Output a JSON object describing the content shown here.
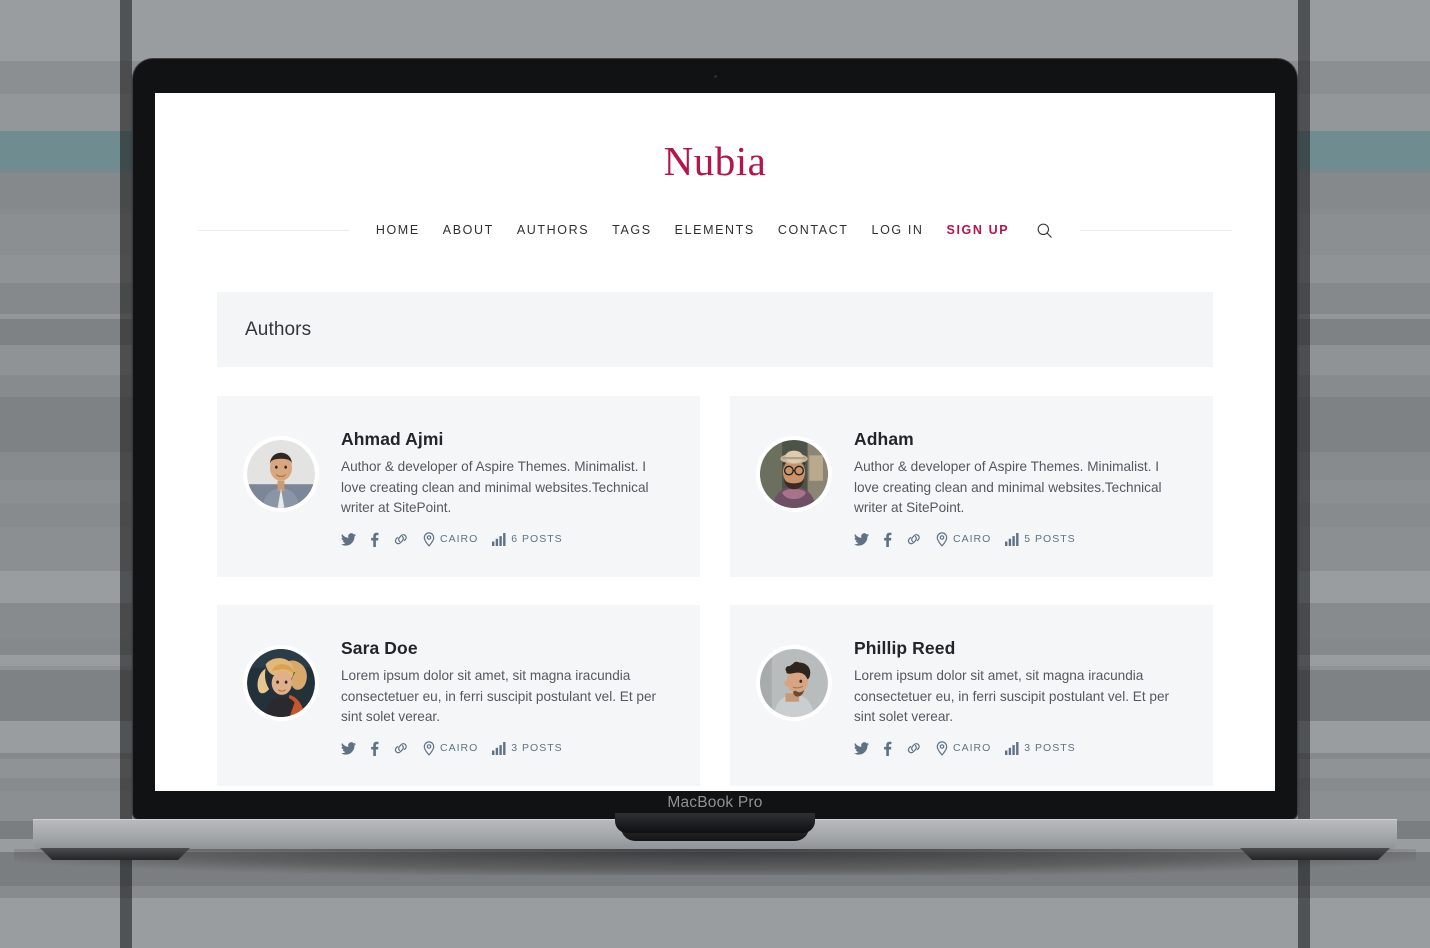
{
  "device": {
    "label": "MacBook Pro"
  },
  "site": {
    "logo": "Nubia",
    "nav": [
      {
        "label": "HOME",
        "accent": false
      },
      {
        "label": "ABOUT",
        "accent": false
      },
      {
        "label": "AUTHORS",
        "accent": false
      },
      {
        "label": "TAGS",
        "accent": false
      },
      {
        "label": "ELEMENTS",
        "accent": false
      },
      {
        "label": "CONTACT",
        "accent": false
      },
      {
        "label": "LOG IN",
        "accent": false
      },
      {
        "label": "SIGN UP",
        "accent": true
      }
    ],
    "search_icon": "search-icon",
    "page_title": "Authors",
    "colors": {
      "accent": "#b4154b",
      "card_bg": "#f4f6f8",
      "page_head_bg": "#f4f5f7",
      "meta_icon": "#5f7285",
      "body_text": "#55585d"
    }
  },
  "authors": [
    {
      "name": "Ahmad Ajmi",
      "bio": "Author & developer of Aspire Themes. Minimalist. I love creating clean and minimal websites.Technical writer at SitePoint.",
      "location": "CAIRO",
      "posts": "6 POSTS",
      "social": [
        "twitter-icon",
        "facebook-icon",
        "link-icon"
      ],
      "avatar": "photo-man-gray-shirt"
    },
    {
      "name": "Adham",
      "bio": "Author & developer of Aspire Themes. Minimalist. I love creating clean and minimal websites.Technical writer at SitePoint.",
      "location": "CAIRO",
      "posts": "5 POSTS",
      "social": [
        "twitter-icon",
        "facebook-icon",
        "link-icon"
      ],
      "avatar": "photo-man-hat-glasses"
    },
    {
      "name": "Sara Doe",
      "bio": "Lorem ipsum dolor sit amet, sit magna iracundia consectetuer eu, in ferri suscipit postulant vel. Et per sint solet verear.",
      "location": "CAIRO",
      "posts": "3 POSTS",
      "social": [
        "twitter-icon",
        "facebook-icon",
        "link-icon"
      ],
      "avatar": "photo-woman-curly-hair"
    },
    {
      "name": "Phillip Reed",
      "bio": "Lorem ipsum dolor sit amet, sit magna iracundia consectetuer eu, in ferri suscipit postulant vel. Et per sint solet verear.",
      "location": "CAIRO",
      "posts": "3 POSTS",
      "social": [
        "twitter-icon",
        "facebook-icon",
        "link-icon"
      ],
      "avatar": "photo-man-gray-tshirt"
    }
  ]
}
